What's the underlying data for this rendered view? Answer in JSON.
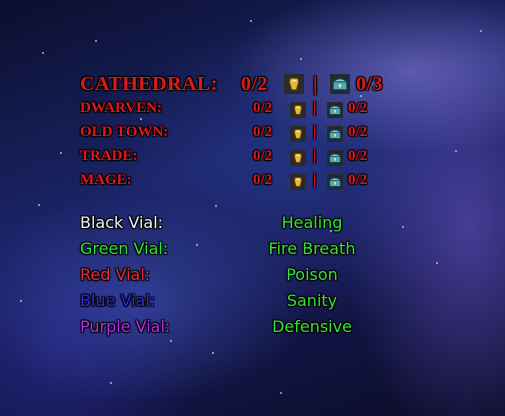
{
  "zones": [
    {
      "name": "CATHEDRAL:",
      "keys": "0/2",
      "separator": "|",
      "chests": "0/3",
      "size": "large"
    },
    {
      "name": "DWARVEN:",
      "keys": "0/2",
      "separator": "|",
      "chests": "0/2",
      "size": "small"
    },
    {
      "name": "OLD TOWN:",
      "keys": "0/2",
      "separator": "|",
      "chests": "0/2",
      "size": "small"
    },
    {
      "name": "TRADE:",
      "keys": "0/2",
      "separator": "|",
      "chests": "0/2",
      "size": "small"
    },
    {
      "name": "MAGE:",
      "keys": "0/2",
      "separator": "|",
      "chests": "0/2",
      "size": "small"
    }
  ],
  "vials": [
    {
      "name": "Black Vial:",
      "effect": "Healing",
      "color": "#f0f0f0"
    },
    {
      "name": "Green Vial:",
      "effect": "Fire Breath",
      "color": "#2fe22f"
    },
    {
      "name": "Red Vial:",
      "effect": "Poison",
      "color": "#e23030"
    },
    {
      "name": "Blue Vial:",
      "effect": "Sanity",
      "color": "#2a2ae6"
    },
    {
      "name": "Purple Vial:",
      "effect": "Defensive",
      "color": "#b030e0"
    }
  ],
  "icons": {
    "key": "key-icon",
    "chest": "chest-icon"
  },
  "colors": {
    "zone_text": "#e01818",
    "effect_text": "#33e233"
  }
}
